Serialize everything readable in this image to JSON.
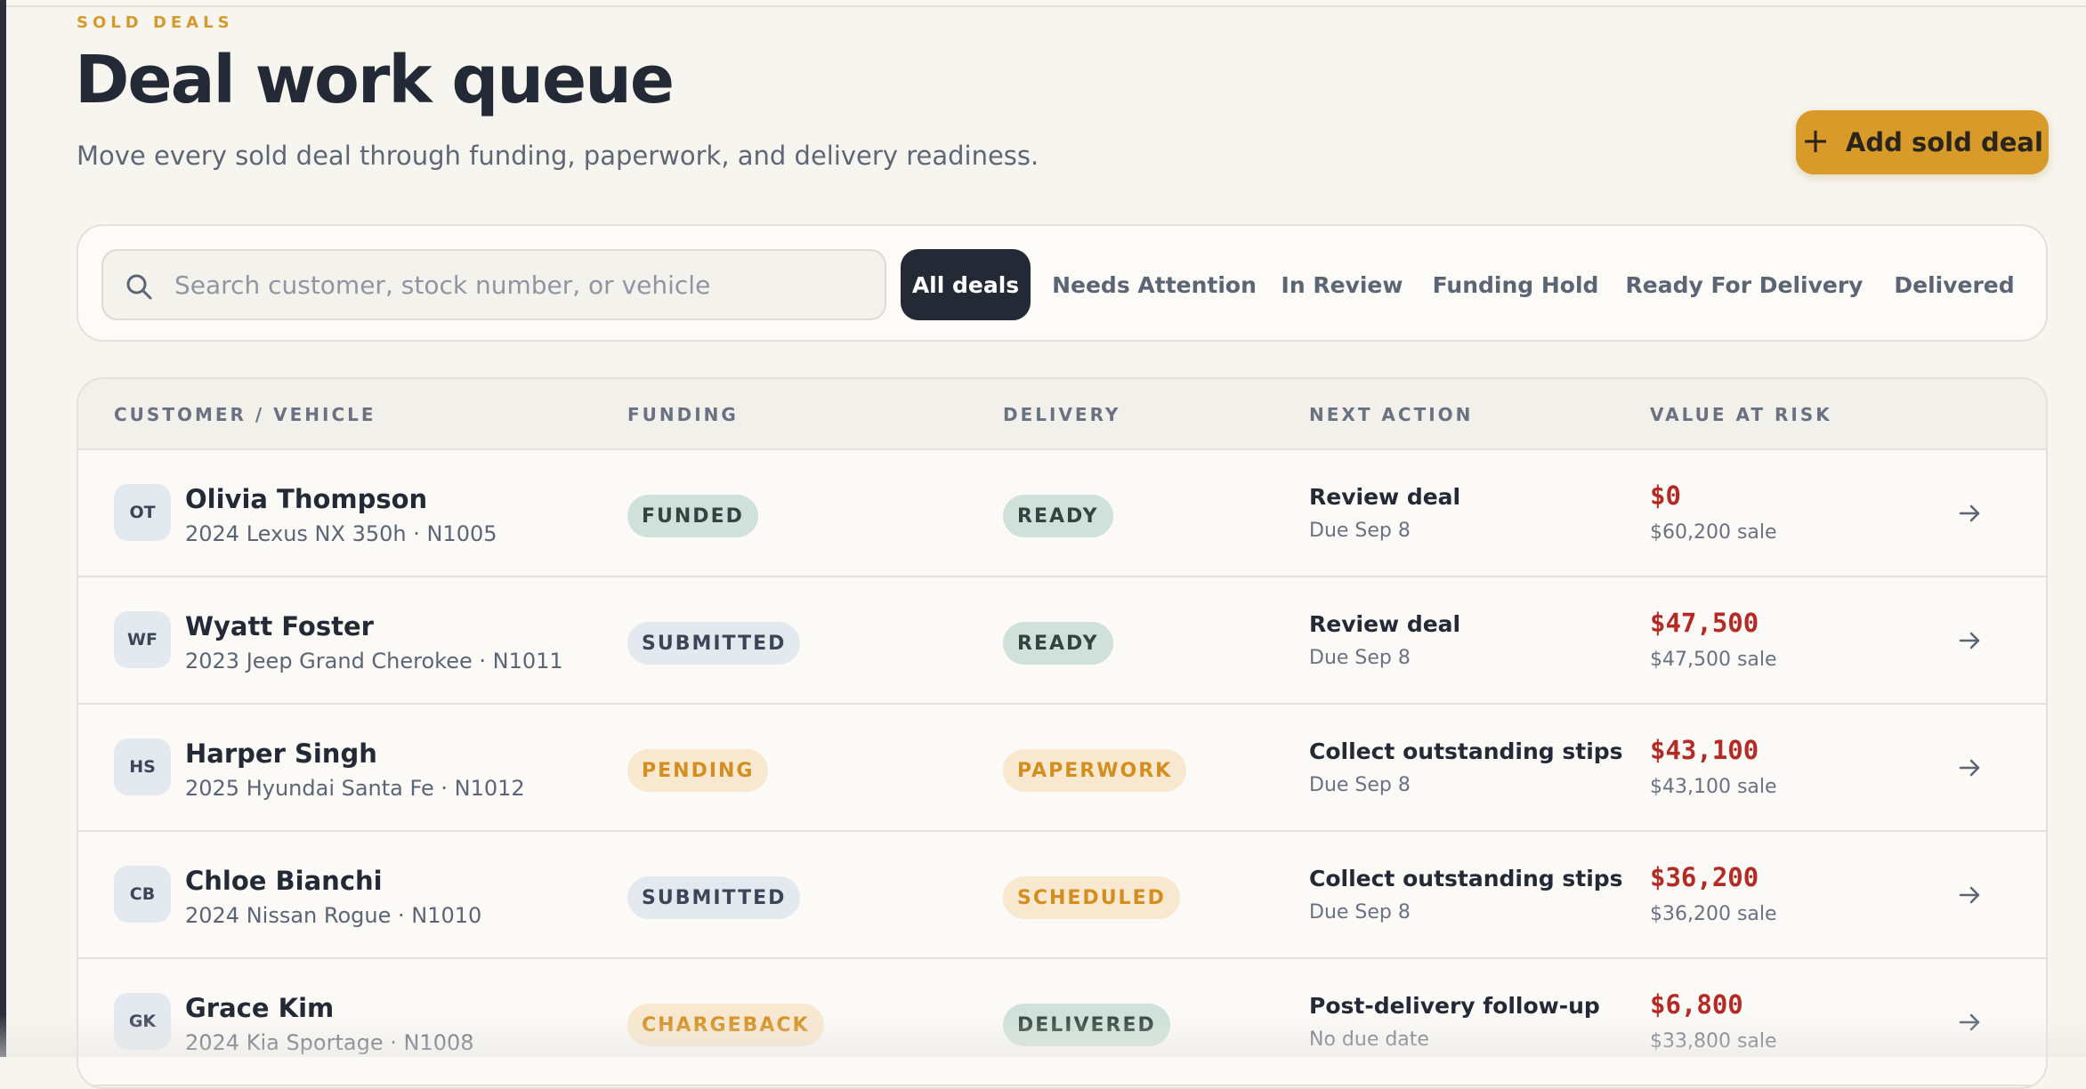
{
  "header": {
    "eyebrow": "SOLD DEALS",
    "title": "Deal work queue",
    "subtitle": "Move every sold deal through funding, paperwork, and delivery readiness.",
    "add_button_label": "Add sold deal",
    "add_icon": "plus-icon"
  },
  "search": {
    "placeholder": "Search customer, stock number, or vehicle",
    "value": "",
    "icon": "search-icon"
  },
  "tabs": [
    {
      "label": "All deals",
      "active": true
    },
    {
      "label": "Needs Attention",
      "active": false
    },
    {
      "label": "In Review",
      "active": false
    },
    {
      "label": "Funding Hold",
      "active": false
    },
    {
      "label": "Ready For Delivery",
      "active": false
    },
    {
      "label": "Delivered",
      "active": false
    }
  ],
  "table": {
    "columns": [
      "CUSTOMER / VEHICLE",
      "FUNDING",
      "DELIVERY",
      "NEXT ACTION",
      "VALUE AT RISK"
    ],
    "rows": [
      {
        "initials": "OT",
        "customer": "Olivia Thompson",
        "vehicle": "2024 Lexus NX 350h · N1005",
        "funding": "FUNDED",
        "delivery": "READY",
        "next_action": "Review deal",
        "due": "Due Sep 8",
        "value_at_risk": "$0",
        "sale": "$60,200 sale"
      },
      {
        "initials": "WF",
        "customer": "Wyatt Foster",
        "vehicle": "2023 Jeep Grand Cherokee · N1011",
        "funding": "SUBMITTED",
        "delivery": "READY",
        "next_action": "Review deal",
        "due": "Due Sep 8",
        "value_at_risk": "$47,500",
        "sale": "$47,500 sale"
      },
      {
        "initials": "HS",
        "customer": "Harper Singh",
        "vehicle": "2025 Hyundai Santa Fe · N1012",
        "funding": "PENDING",
        "delivery": "PAPERWORK",
        "next_action": "Collect outstanding stips",
        "due": "Due Sep 8",
        "value_at_risk": "$43,100",
        "sale": "$43,100 sale"
      },
      {
        "initials": "CB",
        "customer": "Chloe Bianchi",
        "vehicle": "2024 Nissan Rogue · N1010",
        "funding": "SUBMITTED",
        "delivery": "SCHEDULED",
        "next_action": "Collect outstanding stips",
        "due": "Due Sep 8",
        "value_at_risk": "$36,200",
        "sale": "$36,200 sale"
      },
      {
        "initials": "GK",
        "customer": "Grace Kim",
        "vehicle": "2024 Kia Sportage · N1008",
        "funding": "CHARGEBACK",
        "delivery": "DELIVERED",
        "next_action": "Post-delivery follow-up",
        "due": "No due date",
        "value_at_risk": "$6,800",
        "sale": "$33,800 sale"
      }
    ],
    "row_icon": "arrow-right-icon"
  },
  "colors": {
    "accent": "#d89a28",
    "dark": "#242a35",
    "risk_red": "#b42a25",
    "pill_green": "#cfe1da",
    "pill_blue": "#e3e9ef",
    "pill_amber": "#f7e8cf"
  }
}
